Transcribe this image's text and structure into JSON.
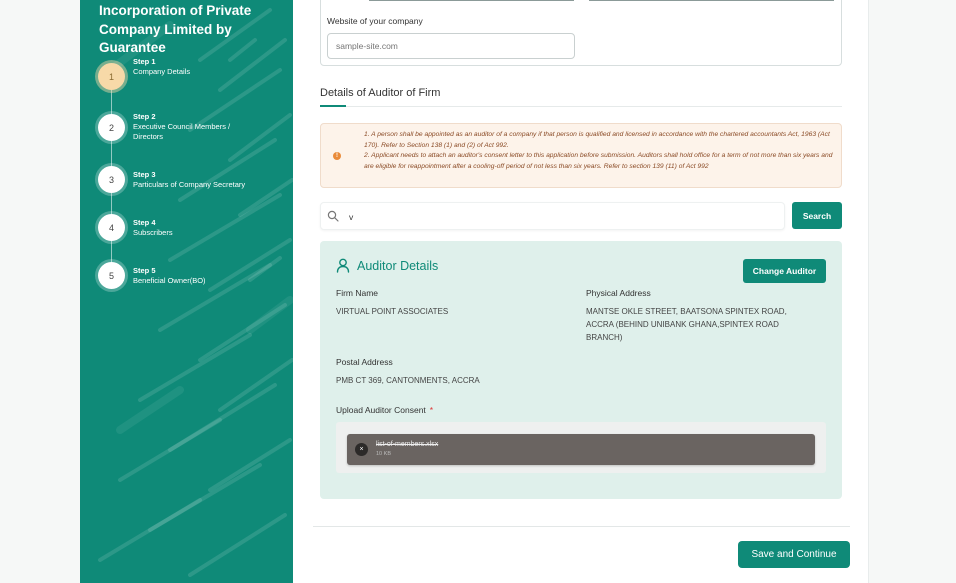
{
  "sidebar": {
    "title": "Incorporation of Private Company Limited by Guarantee",
    "steps": [
      {
        "number": "1",
        "label": "Step 1",
        "name": "Company Details",
        "active": true
      },
      {
        "number": "2",
        "label": "Step 2",
        "name": "Executive Council Members / Directors",
        "active": false
      },
      {
        "number": "3",
        "label": "Step 3",
        "name": "Particulars of Company Secretary",
        "active": false
      },
      {
        "number": "4",
        "label": "Step 4",
        "name": "Subscribers",
        "active": false
      },
      {
        "number": "5",
        "label": "Step 5",
        "name": "Beneficial Owner(BO)",
        "active": false
      }
    ]
  },
  "company_card": {
    "website_label": "Website of your company",
    "website_placeholder": "sample-site.com"
  },
  "auditor_section": {
    "title": "Details of Auditor of Firm",
    "notice_items": [
      "1. A person shall be appointed as an auditor of a company if that person is qualified and licensed in accordance with the chartered accountants Act, 1963 (Act 170). Refer to Section 138 (1) and (2) of Act 992.",
      "2. Applicant needs to attach an auditor's consent letter to this application before submission. Auditors shall hold office for a term of not more than six years and are eligible for reappointment after a cooling-off period of not less than six years. Refer to section 139 (11) of Act 992"
    ],
    "search_value": "v",
    "search_button": "Search"
  },
  "auditor_details": {
    "title": "Auditor Details",
    "change_button": "Change Auditor",
    "firm_name_label": "Firm Name",
    "firm_name": "VIRTUAL POINT ASSOCIATES",
    "physical_address_label": "Physical Address",
    "physical_address": "MANTSE OKLE STREET, BAATSONA SPINTEX ROAD, ACCRA (BEHIND UNIBANK GHANA,SPINTEX ROAD BRANCH)",
    "postal_address_label": "Postal Address",
    "postal_address": "PMB CT 369, CANTONMENTS, ACCRA",
    "upload_label": "Upload Auditor Consent",
    "required_mark": "*",
    "file": {
      "name": "list-of-members.xlsx",
      "size": "10 KB",
      "remove_glyph": "×"
    }
  },
  "footer": {
    "save_button": "Save and Continue"
  },
  "colors": {
    "primary": "#0f8a78",
    "active_step": "#f7d9a8",
    "notice_bg": "#fdf3ea",
    "card_bg": "#dff0eb"
  }
}
